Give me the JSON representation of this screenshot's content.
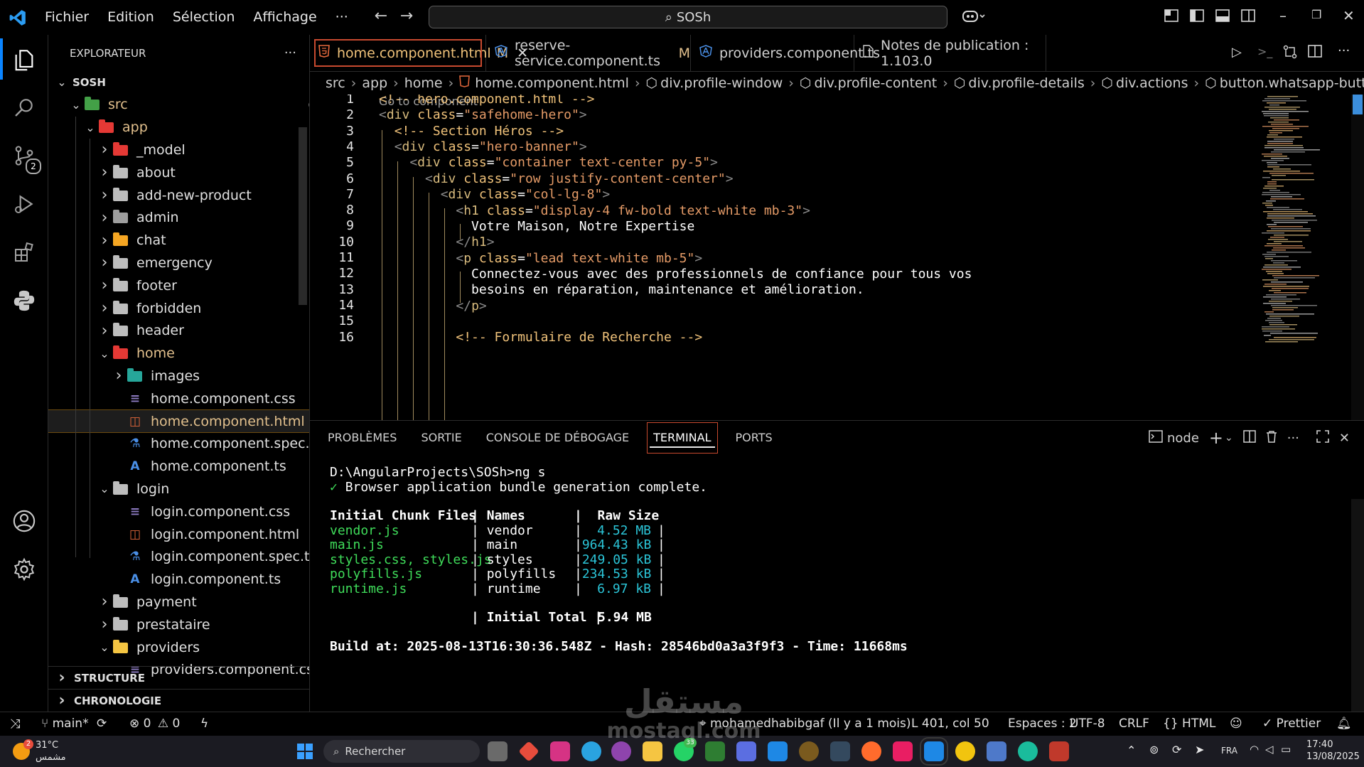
{
  "titlebar": {
    "menus": [
      "Fichier",
      "Edition",
      "Sélection",
      "Affichage"
    ],
    "more": "···",
    "command_center": "SOSh"
  },
  "activity_badge": "2",
  "explorer": {
    "title": "EXPLORATEUR",
    "more": "···",
    "root": "SOSH",
    "items": [
      {
        "label": "src",
        "kind": "folder-open"
      },
      {
        "label": "app",
        "kind": "folder-open"
      },
      {
        "label": "_model",
        "kind": "folder"
      },
      {
        "label": "about",
        "kind": "folder"
      },
      {
        "label": "add-new-product",
        "kind": "folder"
      },
      {
        "label": "admin",
        "kind": "folder"
      },
      {
        "label": "chat",
        "kind": "folder"
      },
      {
        "label": "emergency",
        "kind": "folder"
      },
      {
        "label": "footer",
        "kind": "folder"
      },
      {
        "label": "forbidden",
        "kind": "folder"
      },
      {
        "label": "header",
        "kind": "folder"
      },
      {
        "label": "home",
        "kind": "folder-open"
      },
      {
        "label": "images",
        "kind": "folder"
      },
      {
        "label": "home.component.css",
        "kind": "css"
      },
      {
        "label": "home.component.html",
        "kind": "html"
      },
      {
        "label": "home.component.spec.ts",
        "kind": "spec"
      },
      {
        "label": "home.component.ts",
        "kind": "ts"
      },
      {
        "label": "login",
        "kind": "folder-open"
      },
      {
        "label": "login.component.css",
        "kind": "css"
      },
      {
        "label": "login.component.html",
        "kind": "html"
      },
      {
        "label": "login.component.spec.ts",
        "kind": "spec"
      },
      {
        "label": "login.component.ts",
        "kind": "ts"
      },
      {
        "label": "payment",
        "kind": "folder"
      },
      {
        "label": "prestataire",
        "kind": "folder"
      },
      {
        "label": "providers",
        "kind": "folder-open"
      },
      {
        "label": "providers.component.css",
        "kind": "css"
      }
    ],
    "modified_flag": "M",
    "sections": [
      "STRUCTURE",
      "CHRONOLOGIE"
    ]
  },
  "tabs": [
    {
      "label": "home.component.html",
      "modified": "M",
      "icon": "html-icon"
    },
    {
      "label": "reserve-service.component.ts",
      "modified": "M",
      "icon": "angular-icon"
    },
    {
      "label": "providers.component.ts",
      "modified": "",
      "icon": "angular-icon"
    },
    {
      "label": "Notes de publication : 1.103.0",
      "modified": "",
      "icon": "document-icon"
    }
  ],
  "breadcrumb": [
    "src",
    "app",
    "home",
    "home.component.html",
    "div.profile-window",
    "div.profile-content",
    "div.profile-details",
    "div.actions",
    "button.whatsapp-button"
  ],
  "editor": {
    "codelens": "Go to component",
    "line_numbers": [
      "1",
      "2",
      "3",
      "4",
      "5",
      "6",
      "7",
      "8",
      "9",
      "10",
      "11",
      "12",
      "13",
      "14",
      "15",
      "16"
    ]
  },
  "panel": {
    "tabs": [
      "PROBLÈMES",
      "SORTIE",
      "CONSOLE DE DÉBOGAGE",
      "TERMINAL",
      "PORTS"
    ],
    "shell": "node"
  },
  "terminal": {
    "prompt": "D:\\AngularProjects\\SOSh>ng s",
    "check": "✓",
    "bundle_msg": "Browser application bundle generation complete.",
    "headers": [
      "Initial Chunk Files",
      "Names",
      "Raw Size"
    ],
    "rows": [
      {
        "file": "vendor.js",
        "name": "vendor",
        "size": "4.52 MB"
      },
      {
        "file": "main.js",
        "name": "main",
        "size": "964.43 kB"
      },
      {
        "file": "styles.css, styles.js",
        "name": "styles",
        "size": "249.05 kB"
      },
      {
        "file": "polyfills.js",
        "name": "polyfills",
        "size": "234.53 kB"
      },
      {
        "file": "runtime.js",
        "name": "runtime",
        "size": "6.97 kB"
      }
    ],
    "total_label": "Initial Total",
    "total_size": "5.94 MB",
    "build_line": "Build at: 2025-08-13T16:30:36.548Z - Hash: 28546bd0a3a3f9f3 - Time: 11668ms"
  },
  "statusbar": {
    "branch": "main*",
    "errors": "0",
    "warnings": "0",
    "blame": "mohamedhabibgaf (Il y a 1 mois)",
    "position": "L 401, col 50",
    "spaces": "Espaces : 2",
    "encoding": "UTF-8",
    "eol": "CRLF",
    "language": "HTML",
    "formatter": "Prettier"
  },
  "taskbar": {
    "weather_temp": "31°C",
    "weather_desc": "مشمس",
    "weather_badge": "2",
    "search": "Rechercher",
    "whatsapp_badge": "33",
    "lang": "FRA",
    "time": "17:40",
    "date": "13/08/2025"
  },
  "watermark": {
    "arabic": "مستقل",
    "latin": "mostaql.com"
  },
  "colors": {
    "accent": "#0a84ff",
    "tab_outline": "#c84a2f",
    "modified": "#e2c08d",
    "terminal_green": "#3fdc5a",
    "terminal_cyan": "#2bc5d8"
  }
}
